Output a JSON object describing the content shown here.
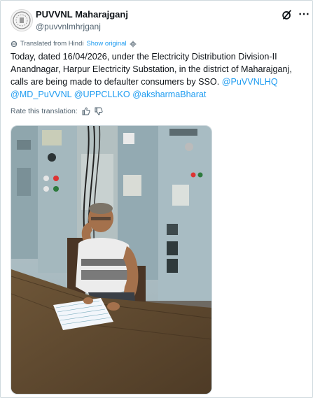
{
  "author": {
    "name": "PUVVNL Maharajganj",
    "handle": "@puvvnlmhrjganj"
  },
  "translation": {
    "note": "Translated from Hindi",
    "show_original": "Show original"
  },
  "post": {
    "text_1": "Today, dated 16/04/2026, under the Electricity Distribution Division-II Anandnagar, Harpur Electricity Substation, in the district of Maharajganj, calls are being made to defaulter consumers by SSO. ",
    "mentions": [
      "@PuVVNLHQ",
      "@MD_PuVVNL",
      "@UPPCLLKO",
      "@aksharmaBharat"
    ]
  },
  "rate": {
    "label": "Rate this translation:"
  },
  "colors": {
    "accent": "#1d9bf0",
    "secondary_text": "#536471",
    "primary_text": "#0f1419"
  },
  "icons": [
    "grok-icon",
    "more-icon",
    "settings-icon",
    "thumbs-up-icon",
    "thumbs-down-icon"
  ]
}
